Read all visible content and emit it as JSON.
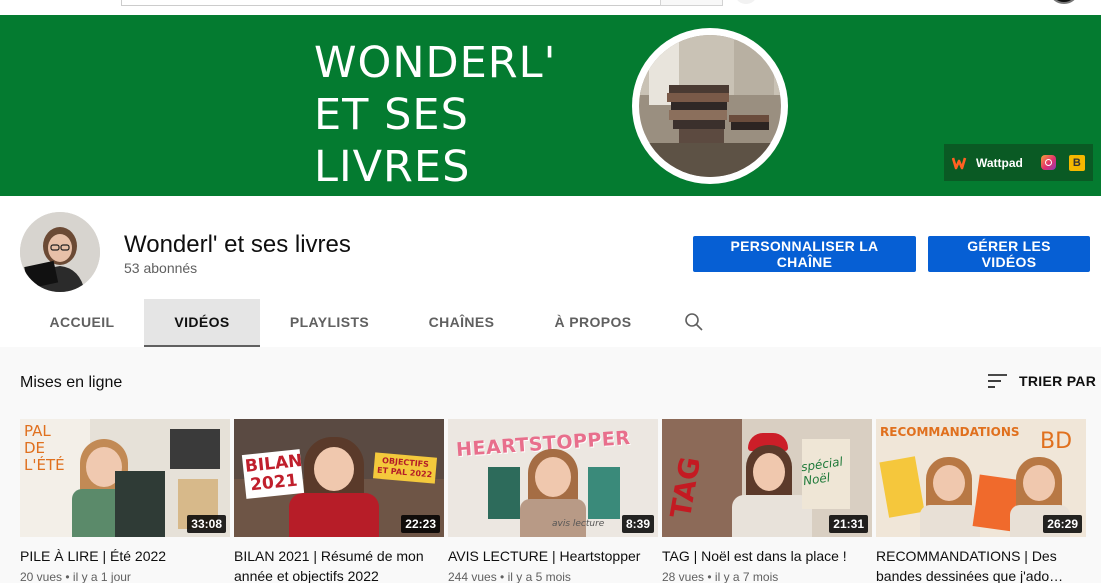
{
  "banner": {
    "title_lines": [
      "WONDERL'",
      "ET SES",
      "LIVRES"
    ],
    "links": {
      "wattpad": "Wattpad",
      "blog_letter": "B"
    }
  },
  "channel": {
    "name": "Wonderl' et ses livres",
    "subscribers": "53 abonnés",
    "customize_label": "PERSONNALISER LA CHAÎNE",
    "manage_label": "GÉRER LES VIDÉOS"
  },
  "tabs": {
    "home": "ACCUEIL",
    "videos": "VIDÉOS",
    "playlists": "PLAYLISTS",
    "channels": "CHAÎNES",
    "about": "À PROPOS"
  },
  "section": {
    "title": "Mises en ligne",
    "sort_label": "TRIER PAR"
  },
  "videos": [
    {
      "title": "PILE À LIRE | Été 2022",
      "meta": "20 vues • il y a 1 jour",
      "duration": "33:08",
      "overlay": "PAL DE L'ÉTÉ"
    },
    {
      "title": "BILAN 2021 | Résumé de mon année et objectifs 2022",
      "meta": "",
      "duration": "22:23",
      "overlay": "BILAN 2021",
      "overlay2": "OBJECTIFS ET PAL 2022"
    },
    {
      "title": "AVIS LECTURE | Heartstopper",
      "meta": "244 vues • il y a 5 mois",
      "duration": "8:39",
      "overlay": "HEARTSTOPPER",
      "overlay2": "avis lecture"
    },
    {
      "title": "TAG | Noël est dans la place !",
      "meta": "28 vues • il y a 7 mois",
      "duration": "21:31",
      "overlay": "TAG",
      "overlay2": "spécial Noël"
    },
    {
      "title": "RECOMMANDATIONS | Des bandes dessinées que j'ado…",
      "meta": "",
      "duration": "26:29",
      "overlay": "RECOMMANDATIONS",
      "overlay2": "BD"
    }
  ],
  "colors": {
    "banner_green": "#047b30",
    "primary_blue": "#065fd4"
  }
}
